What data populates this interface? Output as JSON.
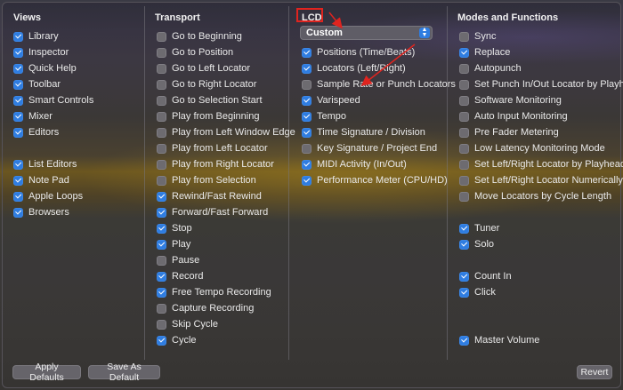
{
  "columns": {
    "views": {
      "title": "Views",
      "items": [
        {
          "label": "Library",
          "checked": true
        },
        {
          "label": "Inspector",
          "checked": true
        },
        {
          "label": "Quick Help",
          "checked": true
        },
        {
          "label": "Toolbar",
          "checked": true
        },
        {
          "label": "Smart Controls",
          "checked": true
        },
        {
          "label": "Mixer",
          "checked": true
        },
        {
          "label": "Editors",
          "checked": true
        },
        {
          "label": "List Editors",
          "checked": true
        },
        {
          "label": "Note Pad",
          "checked": true
        },
        {
          "label": "Apple Loops",
          "checked": true
        },
        {
          "label": "Browsers",
          "checked": true
        }
      ]
    },
    "transport": {
      "title": "Transport",
      "items": [
        {
          "label": "Go to Beginning",
          "checked": false
        },
        {
          "label": "Go to Position",
          "checked": false
        },
        {
          "label": "Go to Left Locator",
          "checked": false
        },
        {
          "label": "Go to Right Locator",
          "checked": false
        },
        {
          "label": "Go to Selection Start",
          "checked": false
        },
        {
          "label": "Play from Beginning",
          "checked": false
        },
        {
          "label": "Play from Left Window Edge",
          "checked": false
        },
        {
          "label": "Play from Left Locator",
          "checked": false
        },
        {
          "label": "Play from Right Locator",
          "checked": false
        },
        {
          "label": "Play from Selection",
          "checked": false
        },
        {
          "label": "Rewind/Fast Rewind",
          "checked": true
        },
        {
          "label": "Forward/Fast Forward",
          "checked": true
        },
        {
          "label": "Stop",
          "checked": true
        },
        {
          "label": "Play",
          "checked": true
        },
        {
          "label": "Pause",
          "checked": false
        },
        {
          "label": "Record",
          "checked": true
        },
        {
          "label": "Free Tempo Recording",
          "checked": true
        },
        {
          "label": "Capture Recording",
          "checked": false
        },
        {
          "label": "Skip Cycle",
          "checked": false
        },
        {
          "label": "Cycle",
          "checked": true
        }
      ]
    },
    "lcd": {
      "title": "LCD",
      "dropdown_value": "Custom",
      "items": [
        {
          "label": "Positions (Time/Beats)",
          "checked": true
        },
        {
          "label": "Locators (Left/Right)",
          "checked": true
        },
        {
          "label": "Sample Rate or Punch Locators",
          "checked": false
        },
        {
          "label": "Varispeed",
          "checked": true
        },
        {
          "label": "Tempo",
          "checked": true
        },
        {
          "label": "Time Signature / Division",
          "checked": true
        },
        {
          "label": "Key Signature / Project End",
          "checked": false
        },
        {
          "label": "MIDI Activity (In/Out)",
          "checked": true
        },
        {
          "label": "Performance Meter (CPU/HD)",
          "checked": true
        }
      ]
    },
    "modes": {
      "title": "Modes and Functions",
      "items": [
        {
          "label": "Sync",
          "checked": false
        },
        {
          "label": "Replace",
          "checked": true
        },
        {
          "label": "Autopunch",
          "checked": false
        },
        {
          "label": "Set Punch In/Out Locator by Playhead",
          "checked": false
        },
        {
          "label": "Software Monitoring",
          "checked": false
        },
        {
          "label": "Auto Input Monitoring",
          "checked": false
        },
        {
          "label": "Pre Fader Metering",
          "checked": false
        },
        {
          "label": "Low Latency Monitoring Mode",
          "checked": false
        },
        {
          "label": "Set Left/Right Locator by Playhead",
          "checked": false
        },
        {
          "label": "Set Left/Right Locator Numerically",
          "checked": false
        },
        {
          "label": "Move Locators by Cycle Length",
          "checked": false
        },
        {
          "label": "Tuner",
          "checked": true
        },
        {
          "label": "Solo",
          "checked": true
        },
        {
          "label": "Count In",
          "checked": true
        },
        {
          "label": "Click",
          "checked": true
        },
        {
          "label": "Master Volume",
          "checked": true
        }
      ]
    }
  },
  "footer": {
    "apply_defaults": "Apply Defaults",
    "save_as_default": "Save As Default",
    "revert": "Revert"
  },
  "colors": {
    "accent": "#2f7de1",
    "highlight": "#e0241f"
  }
}
